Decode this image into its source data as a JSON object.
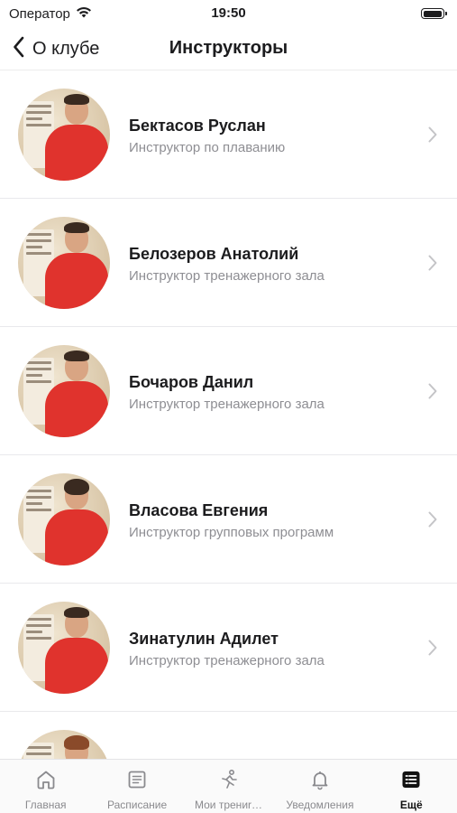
{
  "status": {
    "carrier": "Оператор",
    "time": "19:50"
  },
  "nav": {
    "back_label": "О клубе",
    "title": "Инструкторы"
  },
  "instructors": [
    {
      "name": "Бектасов Руслан",
      "role": "Инструктор по плаванию"
    },
    {
      "name": "Белозеров Анатолий",
      "role": "Инструктор тренажерного зала"
    },
    {
      "name": "Бочаров Данил",
      "role": "Инструктор тренажерного зала"
    },
    {
      "name": "Власова Евгения",
      "role": "Инструктор групповых программ"
    },
    {
      "name": "Зинатулин Адилет",
      "role": "Инструктор тренажерного зала"
    }
  ],
  "tabbar": {
    "items": [
      {
        "label": "Главная",
        "icon": "home-icon"
      },
      {
        "label": "Расписание",
        "icon": "schedule-icon"
      },
      {
        "label": "Мои трениr…",
        "icon": "runner-icon"
      },
      {
        "label": "Уведомления",
        "icon": "bell-icon"
      },
      {
        "label": "Ещё",
        "icon": "more-list-icon",
        "active": true
      }
    ]
  },
  "colors": {
    "accent": "#1c1c1e",
    "secondary_text": "#8e8e93",
    "avatar_shirt": "#e0332d"
  }
}
